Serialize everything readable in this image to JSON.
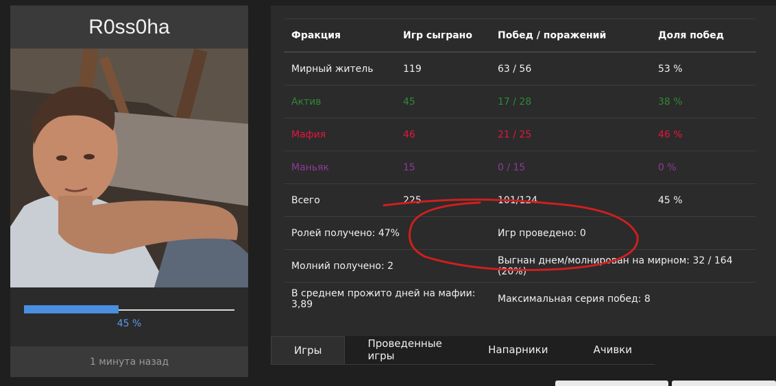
{
  "profile": {
    "username": "R0ss0ha",
    "progress_percent": 45,
    "progress_label": "45 %",
    "last_seen": "1 минута назад"
  },
  "stats": {
    "headers": [
      "Фракция",
      "Игр сыграно",
      "Побед / поражений",
      "Доля побед"
    ],
    "rows": [
      {
        "faction": "Мирный житель",
        "games": "119",
        "wl": "63 / 56",
        "rate": "53 %"
      },
      {
        "faction": "Актив",
        "games": "45",
        "wl": "17 / 28",
        "rate": "38 %"
      },
      {
        "faction": "Мафия",
        "games": "46",
        "wl": "21 / 25",
        "rate": "46 %"
      },
      {
        "faction": "Маньяк",
        "games": "15",
        "wl": "0 / 15",
        "rate": "0 %"
      },
      {
        "faction": "Всего",
        "games": "225",
        "wl": "101/124",
        "rate": "45 %"
      }
    ],
    "extra": {
      "roles_received": "Ролей получено: 47%",
      "games_hosted": "Игр проведено: 0",
      "lightnings_received": "Молний получено: 2",
      "expelled": "Выгнан днем/молнирован на мирном: 32 / 164 (20%)",
      "avg_days_mafia": "В среднем прожито дней на мафии: 3,89",
      "max_win_streak": "Максимальная серия побед: 8"
    },
    "colors": {
      "active": "#2f8a35",
      "mafia": "#e3173f",
      "maniac": "#8e3a98"
    }
  },
  "tabs": [
    "Игры",
    "Проведенные игры",
    "Напарники",
    "Ачивки"
  ]
}
